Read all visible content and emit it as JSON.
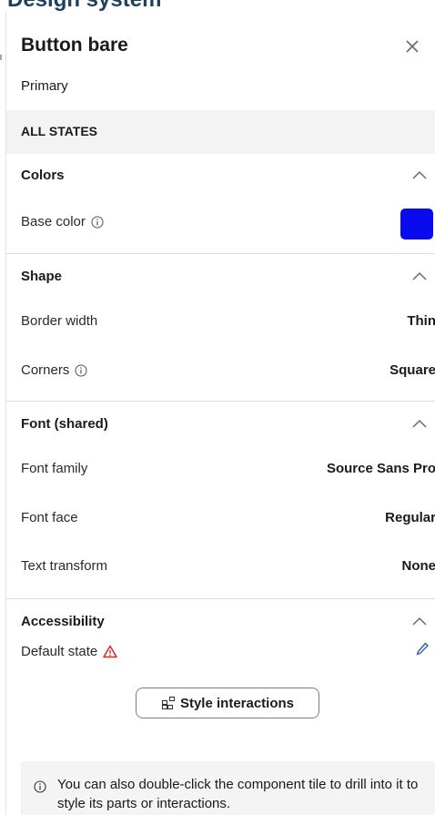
{
  "panel": {
    "title": "Button bare",
    "subtitle": "Primary",
    "close_icon": "close-icon"
  },
  "states_bar": {
    "label": "ALL STATES"
  },
  "sections": {
    "colors": {
      "title": "Colors",
      "rows": {
        "base_color": {
          "label": "Base color",
          "value_color": "#0a0aef"
        }
      }
    },
    "shape": {
      "title": "Shape",
      "rows": {
        "border_width": {
          "label": "Border width",
          "value": "Thin"
        },
        "corners": {
          "label": "Corners",
          "value": "Square"
        }
      }
    },
    "font": {
      "title": "Font (shared)",
      "rows": {
        "font_family": {
          "label": "Font family",
          "value": "Source Sans Pro"
        },
        "font_face": {
          "label": "Font face",
          "value": "Regular"
        },
        "text_transform": {
          "label": "Text transform",
          "value": "None"
        }
      }
    },
    "accessibility": {
      "title": "Accessibility",
      "rows": {
        "default_state": {
          "label": "Default state"
        }
      },
      "style_button": "Style interactions"
    }
  },
  "note": {
    "text": "You can also double-click the component tile to drill into it to style its parts or interactions."
  },
  "colors": {
    "accent_blue": "#0a0aef",
    "warning_red": "#d62828",
    "edit_blue": "#2f5fb3"
  }
}
